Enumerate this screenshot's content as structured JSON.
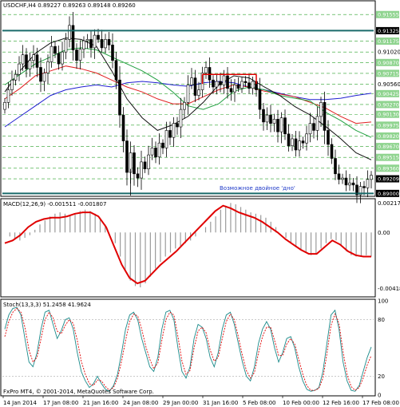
{
  "chart_data": [
    {
      "type": "candlestick",
      "title": "USDCHF,H4 0.89227 0.89263 0.89148 0.89260",
      "symbol": "USDCHF",
      "timeframe": "H4",
      "ohlc_last": {
        "open": 0.89227,
        "high": 0.89263,
        "low": 0.89148,
        "close": 0.8926
      },
      "ylim": [
        0.8897,
        0.9174
      ],
      "y_ticks": [
        0.91555,
        0.91325,
        0.91175,
        0.9102,
        0.9087,
        0.90715,
        0.9056,
        0.90425,
        0.9027,
        0.9013,
        0.89975,
        0.8982,
        0.8967,
        0.89515,
        0.8936,
        0.89209,
        0.89
      ],
      "green_tags": [
        "0.91555",
        "0.91175",
        "0.90870",
        "0.90715",
        "0.90425",
        "0.90270",
        "0.90130",
        "0.89975",
        "0.89820",
        "0.89670",
        "0.89515",
        "0.89360"
      ],
      "black_tags": [
        "0.91325",
        "0.89209",
        "0.89000"
      ],
      "x_ticks": [
        "14 Jan 2014",
        "17 Jan 08:00",
        "21 Jan 16:00",
        "24 Jan 08:00",
        "29 Jan 00:00",
        "31 Jan 16:00",
        "5 Feb 08:00",
        "10 Feb 00:00",
        "12 Feb 16:00",
        "17 Feb 08:00"
      ],
      "annotation": "Возможное двойное 'дно'",
      "support_level": 0.89,
      "resistance_level": 0.91325,
      "top_box": {
        "from_bar": 55,
        "to_bar": 70,
        "level": 0.907
      },
      "close": [
        0.903,
        0.9048,
        0.9062,
        0.907,
        0.9085,
        0.9098,
        0.9078,
        0.909,
        0.9098,
        0.908,
        0.906,
        0.9072,
        0.9088,
        0.911,
        0.91,
        0.9085,
        0.9102,
        0.912,
        0.914,
        0.9105,
        0.909,
        0.9106,
        0.9118,
        0.912,
        0.9108,
        0.9126,
        0.912,
        0.9108,
        0.912,
        0.9112,
        0.909,
        0.9062,
        0.9012,
        0.8975,
        0.893,
        0.8958,
        0.8928,
        0.8922,
        0.8945,
        0.8935,
        0.8955,
        0.8965,
        0.8952,
        0.8972,
        0.8965,
        0.899,
        0.898,
        0.9,
        0.8995,
        0.902,
        0.903,
        0.9055,
        0.9065,
        0.904,
        0.9048,
        0.9072,
        0.908,
        0.9062,
        0.9052,
        0.906,
        0.9055,
        0.9068,
        0.905,
        0.9045,
        0.9055,
        0.905,
        0.906,
        0.9058,
        0.905,
        0.906,
        0.9048,
        0.902,
        0.9002,
        0.9012,
        0.9,
        0.9006,
        0.8988,
        0.9008,
        0.8985,
        0.8968,
        0.8978,
        0.8962,
        0.8975,
        0.8972,
        0.8985,
        0.9,
        0.899,
        0.901,
        0.903,
        0.899,
        0.897,
        0.895,
        0.8928,
        0.892,
        0.8922,
        0.8912,
        0.8915,
        0.8912,
        0.8898,
        0.891,
        0.8908,
        0.892,
        0.8926
      ],
      "ma_series": [
        {
          "color": "#1f1fd0",
          "values": [
            0.8995,
            0.901,
            0.9025,
            0.904,
            0.9048,
            0.9052,
            0.9055,
            0.9052,
            0.9058,
            0.906,
            0.9058,
            0.9055,
            0.9053,
            0.9058,
            0.906,
            0.9058,
            0.9052,
            0.9048,
            0.9043,
            0.9038,
            0.9034,
            0.9034,
            0.9036,
            0.904,
            0.9043
          ]
        },
        {
          "color": "#e02020",
          "values": [
            0.9035,
            0.905,
            0.9068,
            0.9075,
            0.9082,
            0.9078,
            0.9072,
            0.9062,
            0.9052,
            0.9045,
            0.9035,
            0.9028,
            0.9028,
            0.9038,
            0.9048,
            0.9055,
            0.9052,
            0.9046,
            0.9042,
            0.9038,
            0.903,
            0.9022,
            0.901,
            0.9,
            0.9002
          ]
        },
        {
          "color": "#20a040",
          "values": [
            0.9055,
            0.907,
            0.9085,
            0.9095,
            0.9105,
            0.9108,
            0.9105,
            0.9095,
            0.9085,
            0.9075,
            0.9062,
            0.9045,
            0.9025,
            0.902,
            0.9028,
            0.9046,
            0.9052,
            0.9048,
            0.904,
            0.9036,
            0.9032,
            0.9016,
            0.9004,
            0.899,
            0.898
          ]
        },
        {
          "color": "#111111",
          "values": [
            0.9045,
            0.9075,
            0.91,
            0.9115,
            0.9122,
            0.912,
            0.911,
            0.9075,
            0.9035,
            0.9008,
            0.899,
            0.8998,
            0.901,
            0.903,
            0.9055,
            0.9068,
            0.9065,
            0.9052,
            0.904,
            0.9024,
            0.9012,
            0.8996,
            0.8978,
            0.8958,
            0.8948
          ]
        }
      ]
    },
    {
      "type": "bar+line",
      "title": "MACD(12,26,9) -0.001511 -0.001807",
      "values_label": [
        "-0.001511",
        "-0.001807"
      ],
      "ylim": [
        -0.00475,
        0.0024
      ],
      "y_ticks": [
        0.002177,
        0.0,
        -0.004188
      ],
      "y_tick_labels": [
        "0.002177",
        "0.00",
        "-0.004188"
      ],
      "signal_color": "#e00000",
      "histogram": [
        -0.0,
        -0.0003,
        -0.0005,
        -0.0006,
        -0.0004,
        -0.0002,
        0.0002,
        0.0006,
        0.0009,
        0.0012,
        0.0014,
        0.0015,
        0.0014,
        0.0013,
        0.0014,
        0.0016,
        0.0017,
        0.0016,
        0.0014,
        0.0011,
        0.0006,
        0.0,
        -0.0008,
        -0.0018,
        -0.0028,
        -0.0036,
        -0.004,
        -0.0041,
        -0.0038,
        -0.0033,
        -0.0027,
        -0.0022,
        -0.0018,
        -0.0015,
        -0.0012,
        -0.001,
        -0.0008,
        -0.0006,
        -0.0003,
        0.0,
        0.0004,
        0.0008,
        0.0012,
        0.0017,
        0.002,
        0.0022,
        0.0021,
        0.0019,
        0.0017,
        0.0015,
        0.0014,
        0.0013,
        0.0011,
        0.0008,
        0.0004,
        0.0,
        -0.0004,
        -0.0008,
        -0.0011,
        -0.0013,
        -0.0015,
        -0.0017,
        -0.0016,
        -0.0012,
        -0.0008,
        -0.0005,
        -0.0006,
        -0.001,
        -0.0014,
        -0.0017,
        -0.0018,
        -0.0018,
        -0.0017,
        -0.0018
      ],
      "signal": [
        -0.0008,
        -0.0006,
        -0.0002,
        0.0004,
        0.0008,
        0.001,
        0.0011,
        0.0011,
        0.0012,
        0.0014,
        0.0015,
        0.0015,
        0.0012,
        0.0004,
        -0.001,
        -0.0024,
        -0.0034,
        -0.0038,
        -0.0036,
        -0.003,
        -0.0024,
        -0.0019,
        -0.0014,
        -0.0008,
        -0.0002,
        0.0004,
        0.001,
        0.0016,
        0.002,
        0.0018,
        0.0015,
        0.0013,
        0.0011,
        0.0008,
        0.0004,
        0.0,
        -0.0005,
        -0.0009,
        -0.0013,
        -0.0016,
        -0.0016,
        -0.0011,
        -0.0006,
        -0.0009,
        -0.0014,
        -0.0017,
        -0.0018,
        -0.0018
      ]
    },
    {
      "type": "line",
      "title": "Stoch(13,3,3) 51.2458 41.9624",
      "values_label": [
        "51.2458",
        "41.9624"
      ],
      "ylim": [
        0,
        100
      ],
      "y_ticks": [
        100,
        80,
        20,
        0
      ],
      "y_tick_labels": [
        "100",
        "80",
        "20",
        "0"
      ],
      "main_color": "#1a8a8a",
      "signal_color": "#e00000",
      "main": [
        70,
        85,
        92,
        93,
        85,
        60,
        35,
        30,
        45,
        70,
        88,
        90,
        75,
        60,
        68,
        80,
        82,
        70,
        45,
        25,
        15,
        8,
        12,
        20,
        12,
        6,
        4,
        10,
        22,
        45,
        70,
        85,
        88,
        80,
        60,
        45,
        30,
        25,
        40,
        70,
        88,
        90,
        80,
        50,
        25,
        18,
        30,
        60,
        75,
        72,
        60,
        40,
        30,
        45,
        70,
        85,
        88,
        75,
        55,
        35,
        20,
        15,
        30,
        55,
        70,
        78,
        70,
        50,
        35,
        45,
        60,
        62,
        50,
        30,
        15,
        6,
        4,
        5,
        8,
        25,
        55,
        85,
        90,
        70,
        35,
        15,
        5,
        4,
        10,
        25,
        40,
        51
      ],
      "signal": [
        62,
        78,
        88,
        92,
        88,
        72,
        48,
        35,
        40,
        60,
        80,
        88,
        82,
        68,
        65,
        74,
        80,
        76,
        58,
        36,
        22,
        12,
        10,
        16,
        15,
        9,
        5,
        8,
        18,
        36,
        58,
        78,
        86,
        84,
        70,
        52,
        38,
        28,
        34,
        58,
        80,
        88,
        85,
        62,
        36,
        22,
        26,
        50,
        68,
        72,
        66,
        48,
        36,
        40,
        60,
        78,
        86,
        80,
        62,
        42,
        26,
        18,
        24,
        45,
        62,
        72,
        72,
        58,
        42,
        42,
        54,
        60,
        54,
        38,
        22,
        10,
        5,
        5,
        7,
        18,
        44,
        74,
        86,
        76,
        46,
        22,
        9,
        5,
        8,
        18,
        32,
        42
      ]
    }
  ],
  "footer": {
    "copyright": "FxPro MT4, © 2001-2014, MetaQuotes Software Corp."
  },
  "colors": {
    "green_tag": "#8fd48f",
    "black_tag": "#000000",
    "support_line": "#1a6b6b",
    "grid_dash": "#2aa02a",
    "macd_signal": "#e00000",
    "stoch_main": "#1a8a8a",
    "stoch_signal": "#e00000"
  }
}
